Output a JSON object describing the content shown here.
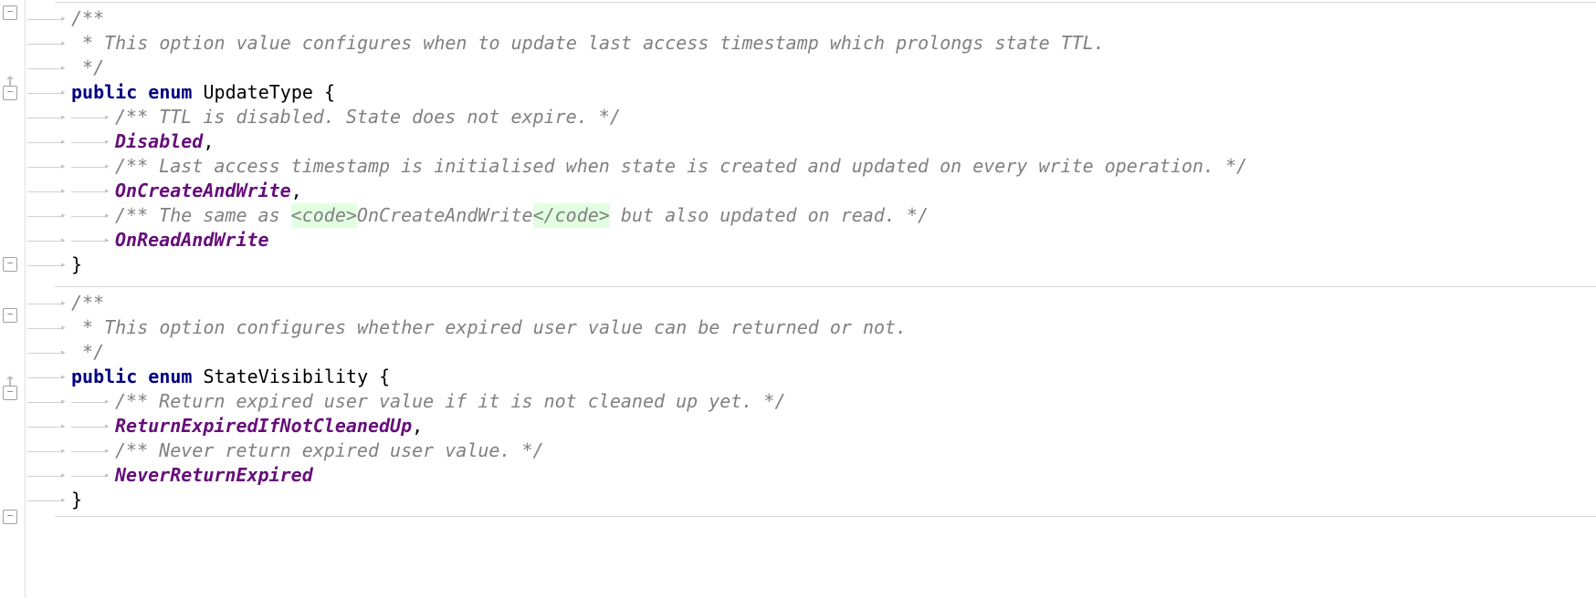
{
  "block1": {
    "docOpen": "/**",
    "docLine": " * This option value configures when to update last access timestamp which prolongs state TTL.",
    "docClose": " */",
    "decl_public": "public",
    "decl_enum": "enum",
    "decl_name": "UpdateType",
    "decl_brace": " {",
    "item1_doc": "/** TTL is disabled. State does not expire. */",
    "item1_name": "Disabled",
    "item1_sep": ",",
    "item2_doc": "/** Last access timestamp is initialised when state is created and updated on every write operation. */",
    "item2_name": "OnCreateAndWrite",
    "item2_sep": ",",
    "item3_doc_pre": "/** The same as ",
    "item3_codeopen": "<code>",
    "item3_codeval": "OnCreateAndWrite",
    "item3_codeclose": "</code>",
    "item3_doc_post": " but also updated on read. */",
    "item3_name": "OnReadAndWrite",
    "close_brace": "}"
  },
  "block2": {
    "docOpen": "/**",
    "docLine": " * This option configures whether expired user value can be returned or not.",
    "docClose": " */",
    "decl_public": "public",
    "decl_enum": "enum",
    "decl_name": "StateVisibility",
    "decl_brace": " {",
    "item1_doc": "/** Return expired user value if it is not cleaned up yet. */",
    "item1_name": "ReturnExpiredIfNotCleanedUp",
    "item1_sep": ",",
    "item2_doc": "/** Never return expired user value. */",
    "item2_name": "NeverReturnExpired",
    "close_brace": "}"
  }
}
